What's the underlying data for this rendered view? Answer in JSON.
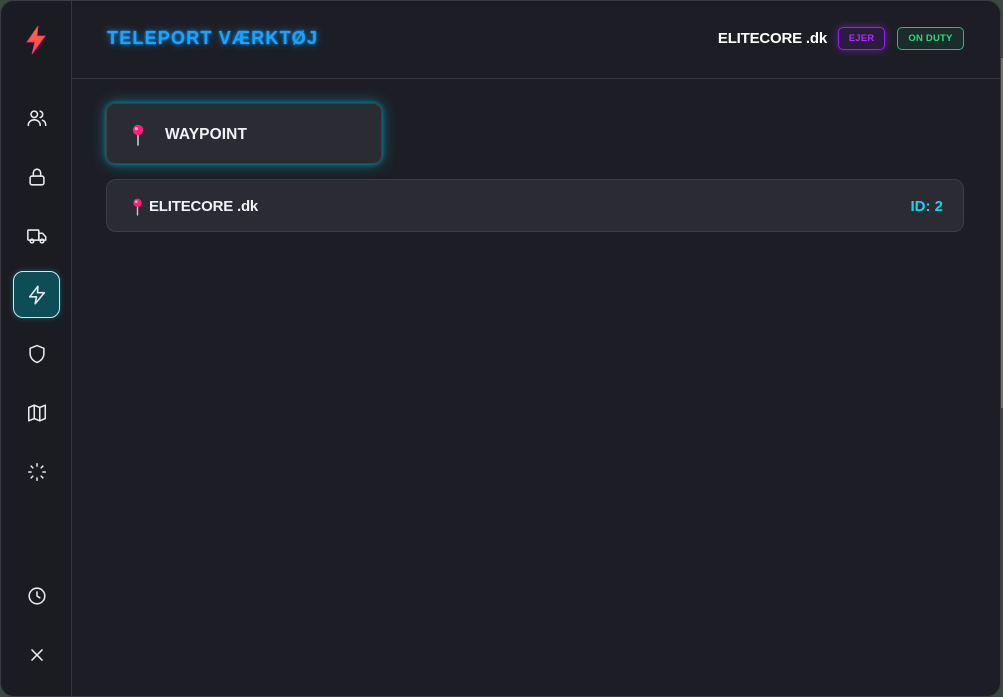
{
  "header": {
    "title": "TELEPORT VÆRKTØJ",
    "user_name": "ELITECORE .dk",
    "badges": {
      "owner": "EJER",
      "duty": "ON DUTY"
    }
  },
  "sidebar": {
    "logo_icon": "lightning-bolt-icon",
    "items": [
      {
        "icon": "users-icon",
        "active": false
      },
      {
        "icon": "lock-icon",
        "active": false
      },
      {
        "icon": "truck-icon",
        "active": false
      },
      {
        "icon": "lightning-icon",
        "active": true
      },
      {
        "icon": "shield-icon",
        "active": false
      },
      {
        "icon": "map-icon",
        "active": false
      },
      {
        "icon": "loader-icon",
        "active": false
      },
      {
        "icon": "clock-icon",
        "active": false
      },
      {
        "icon": "close-icon",
        "active": false
      }
    ]
  },
  "main": {
    "waypoint_label": "WAYPOINT",
    "players": [
      {
        "name": "ELITECORE .dk",
        "id": "ID: 2"
      }
    ]
  },
  "colors": {
    "accent": "#1aa3ff",
    "owner": "#9b1ff0",
    "duty": "#18c46e",
    "id": "#18d4ee",
    "pin": "#ff1f7a"
  }
}
